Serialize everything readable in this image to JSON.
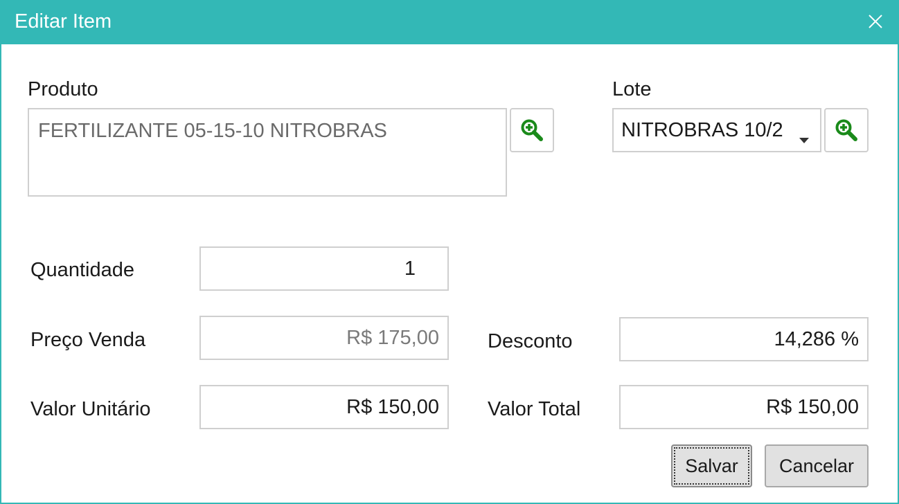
{
  "window": {
    "title": "Editar Item",
    "close_icon": "close-icon"
  },
  "produto": {
    "label": "Produto",
    "value": "FERTILIZANTE 05-15-10 NITROBRAS",
    "search_icon": "zoom-in-icon"
  },
  "lote": {
    "label": "Lote",
    "value": "NITROBRAS 10/2",
    "search_icon": "zoom-in-icon"
  },
  "quantidade": {
    "label": "Quantidade",
    "value": "1"
  },
  "preco_venda": {
    "label": "Preço Venda",
    "value": "R$ 175,00"
  },
  "desconto": {
    "label": "Desconto",
    "value": "14,286 %"
  },
  "valor_unitario": {
    "label": "Valor Unitário",
    "value": "R$ 150,00"
  },
  "valor_total": {
    "label": "Valor Total",
    "value": "R$ 150,00"
  },
  "buttons": {
    "save": "Salvar",
    "cancel": "Cancelar"
  },
  "colors": {
    "titlebar": "#33b8b6",
    "search_icon": "#1a8a1a",
    "field_border": "#cfcfcf",
    "button_bg": "#e1e1e1"
  }
}
